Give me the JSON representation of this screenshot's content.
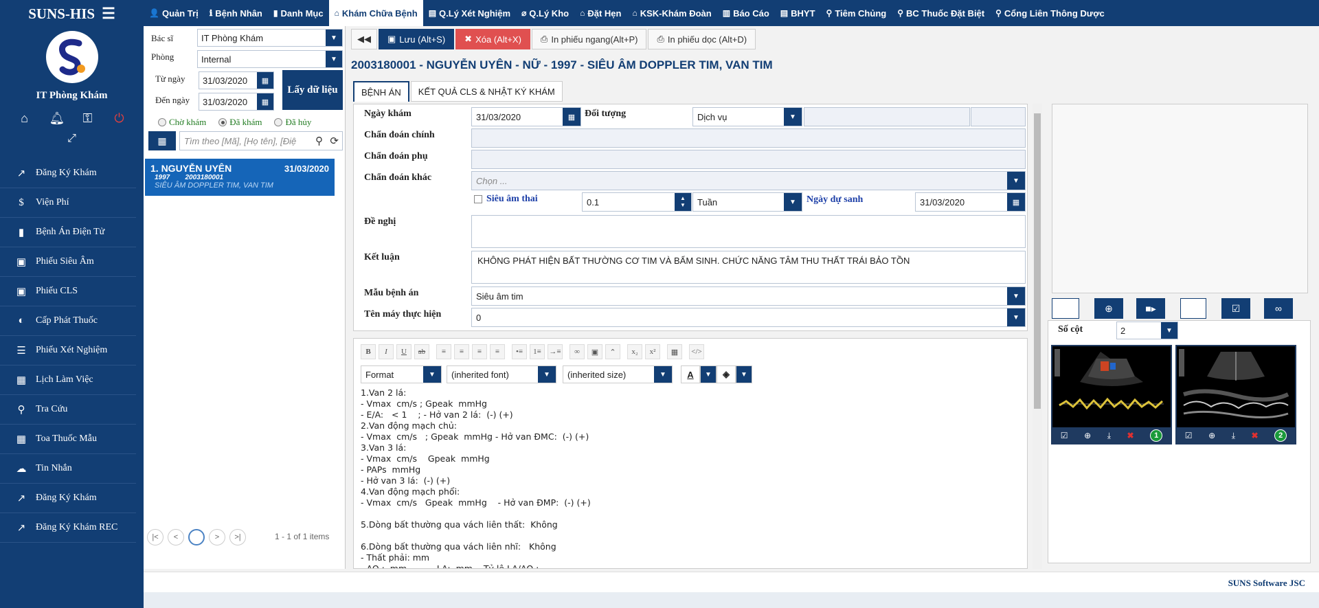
{
  "sidebar": {
    "brand": "SUNS-HIS",
    "org_name": "IT Phòng Khám",
    "menu": [
      {
        "icon": "external-link-icon",
        "glyph": "↗",
        "label": "Đăng Ký Khám"
      },
      {
        "icon": "dollar-icon",
        "glyph": "$",
        "label": "Viện Phí"
      },
      {
        "icon": "book-icon",
        "glyph": "▮",
        "label": "Bệnh Án Điện Tử"
      },
      {
        "icon": "image-icon",
        "glyph": "▣",
        "label": "Phiếu Siêu Âm"
      },
      {
        "icon": "image-icon",
        "glyph": "▣",
        "label": "Phiếu CLS"
      },
      {
        "icon": "contrast-icon",
        "glyph": "◐",
        "label": "Cấp Phát Thuốc"
      },
      {
        "icon": "tasks-icon",
        "glyph": "☰",
        "label": "Phiếu Xét Nghiệm"
      },
      {
        "icon": "calendar-icon",
        "glyph": "▦",
        "label": "Lịch Làm Việc"
      },
      {
        "icon": "search-icon",
        "glyph": "⚲",
        "label": "Tra Cứu"
      },
      {
        "icon": "grid-icon",
        "glyph": "▦",
        "label": "Toa Thuốc Mẫu"
      },
      {
        "icon": "cloud-icon",
        "glyph": "☁",
        "label": "Tin Nhắn"
      },
      {
        "icon": "external-link-icon",
        "glyph": "↗",
        "label": "Đăng Ký Khám"
      },
      {
        "icon": "external-link-icon",
        "glyph": "↗",
        "label": "Đăng Ký Khám REC"
      }
    ]
  },
  "topnav": [
    {
      "icon": "user-icon",
      "glyph": "👤",
      "label": "Quản Trị",
      "active": false
    },
    {
      "icon": "info-icon",
      "glyph": "ℹ",
      "label": "Bệnh Nhân",
      "active": false
    },
    {
      "icon": "book-icon",
      "glyph": "▮",
      "label": "Danh Mục",
      "active": false
    },
    {
      "icon": "home-icon",
      "glyph": "⌂",
      "label": "Khám Chữa Bệnh",
      "active": true
    },
    {
      "icon": "list-icon",
      "glyph": "▤",
      "label": "Q.Lý Xét Nghiệm",
      "active": false
    },
    {
      "icon": "tag-icon",
      "glyph": "⌀",
      "label": "Q.Lý Kho",
      "active": false
    },
    {
      "icon": "home-icon",
      "glyph": "⌂",
      "label": "Đặt Hẹn",
      "active": false
    },
    {
      "icon": "home-icon",
      "glyph": "⌂",
      "label": "KSK-Khám Đoàn",
      "active": false
    },
    {
      "icon": "bar-chart-icon",
      "glyph": "▥",
      "label": "Báo Cáo",
      "active": false
    },
    {
      "icon": "list-icon",
      "glyph": "▤",
      "label": "BHYT",
      "active": false
    },
    {
      "icon": "pin-icon",
      "glyph": "⚲",
      "label": "Tiêm Chủng",
      "active": false
    },
    {
      "icon": "pin-icon",
      "glyph": "⚲",
      "label": "BC Thuốc Đặt Biệt",
      "active": false
    },
    {
      "icon": "pin-icon",
      "glyph": "⚲",
      "label": "Cổng Liên Thông Dược",
      "active": false
    }
  ],
  "filters": {
    "doctor_label": "Bác sĩ",
    "doctor_value": "IT Phòng Khám",
    "room_label": "Phòng",
    "room_value": "Internal",
    "from_label": "Từ ngày",
    "from_value": "31/03/2020",
    "to_label": "Đến ngày",
    "to_value": "31/03/2020",
    "get_data_button": "Lấy dữ liệu",
    "radio_waiting": "Chờ khám",
    "radio_done": "Đã khám",
    "radio_cancelled": "Đã hủy",
    "selected_radio": "Đã khám",
    "search_placeholder": "Tìm theo [Mã], [Họ tên], [Điệ"
  },
  "patients": [
    {
      "name": "1. NGUYỄN UYÊN",
      "date": "31/03/2020",
      "year": "1997",
      "code": "2003180001",
      "service": "SIÊU ÂM DOPPLER TIM, VAN TIM"
    }
  ],
  "pager": {
    "current_page": "1",
    "info": "1 - 1 of 1 items"
  },
  "toolbar": {
    "save": "Lưu (Alt+S)",
    "delete": "Xóa (Alt+X)",
    "print_landscape": "In phiếu ngang(Alt+P)",
    "print_portrait": "In phiếu dọc (Alt+D)"
  },
  "header_title": "2003180001 - NGUYỄN UYÊN - NỮ - 1997 - SIÊU ÂM DOPPLER TIM, VAN TIM",
  "tabs": [
    {
      "label": "BỆNH ÁN",
      "active": true
    },
    {
      "label": "KẾT QUẢ CLS & NHẬT KÝ KHÁM",
      "active": false
    }
  ],
  "form": {
    "exam_date_label": "Ngày khám",
    "exam_date_value": "31/03/2020",
    "subject_label": "Đối tượng",
    "subject_value": "Dịch vụ",
    "main_diag_label": "Chẩn đoán chính",
    "sub_diag_label": "Chẩn đoán phụ",
    "other_diag_label": "Chẩn đoán khác",
    "other_diag_placeholder": "Chọn ...",
    "pregnancy_label": "Siêu âm thai",
    "pregnancy_value": "0.1",
    "week_unit": "Tuần",
    "due_date_label": "Ngày dự sanh",
    "due_date_value": "31/03/2020",
    "suggest_label": "Đề nghị",
    "conclusion_label": "Kết luận",
    "conclusion_value": "KHÔNG PHÁT HIỆN BẤT THƯỜNG CƠ TIM VÀ BẨM SINH. CHỨC NĂNG TÂM THU THẤT TRÁI BẢO TỒN",
    "template_label": "Mẫu bệnh án",
    "template_value": "Siêu âm tim",
    "machine_label": "Tên máy thực hiện",
    "machine_value": "0"
  },
  "editor": {
    "format": "Format",
    "font": "(inherited font)",
    "size": "(inherited size)",
    "body": "1.Van 2 lá:\n- Vmax  cm/s ; Gpeak  mmHg\n- E/A:   < 1    ; - Hở van 2 lá:  (-) (+)\n2.Van động mạch chủ:\n- Vmax  cm/s   ; Gpeak  mmHg - Hở van ĐMC:  (-) (+)\n3.Van 3 lá:\n- Vmax  cm/s    Gpeak  mmHg\n- PAPs  mmHg\n- Hở van 3 lá:  (-) (+)\n4.Van động mạch phổi:\n- Vmax  cm/s   Gpeak  mmHg    - Hở van ĐMP:  (-) (+)\n\n5.Dòng bất thường qua vách liên thất:  Không\n\n6.Dòng bất thường qua vách liên nhĩ:   Không\n- Thất phải: mm\n- AO :  mm,          LA:  mm,   Tỷ lệ LA/AO :"
  },
  "images": {
    "columns_label": "Số cột",
    "columns_value": "2",
    "items": [
      {
        "number": "1"
      },
      {
        "number": "2"
      }
    ]
  },
  "footer": {
    "brand": "SUNS Software JSC"
  }
}
